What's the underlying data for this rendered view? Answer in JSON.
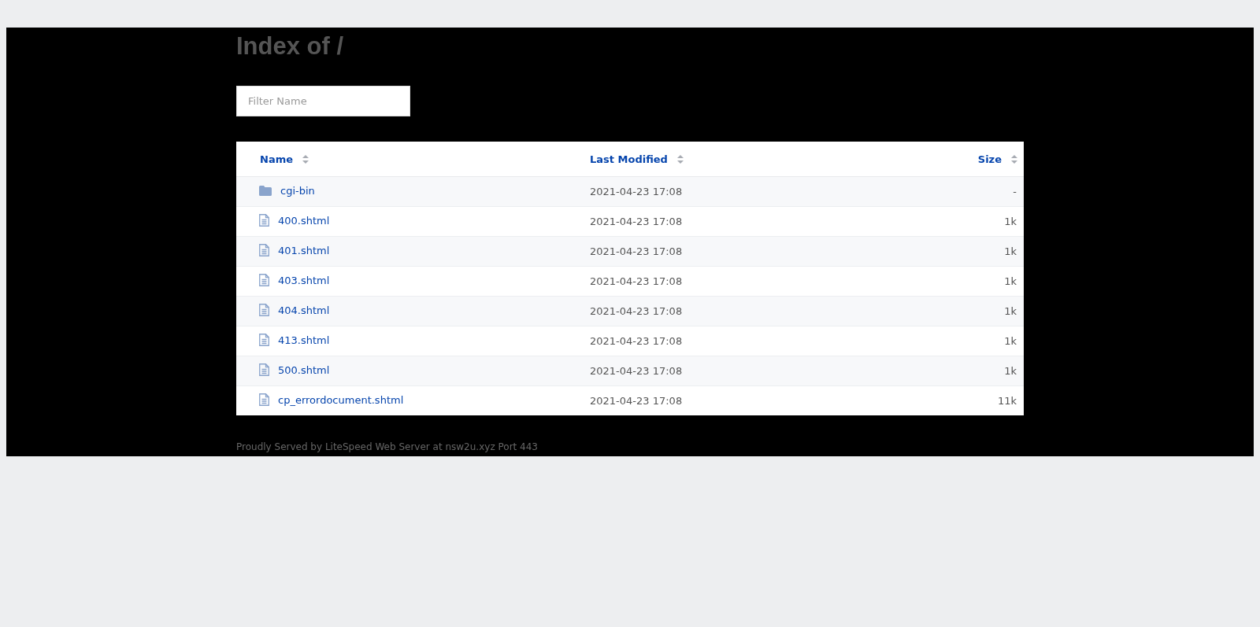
{
  "title": "Index of /",
  "filter": {
    "placeholder": "Filter Name"
  },
  "table": {
    "columns": [
      "Name",
      "Last Modified",
      "Size"
    ],
    "rows": [
      {
        "kind": "folder",
        "name": "cgi-bin",
        "modified": "2021-04-23 17:08",
        "size": "-"
      },
      {
        "kind": "file",
        "name": "400.shtml",
        "modified": "2021-04-23 17:08",
        "size": "1k"
      },
      {
        "kind": "file",
        "name": "401.shtml",
        "modified": "2021-04-23 17:08",
        "size": "1k"
      },
      {
        "kind": "file",
        "name": "403.shtml",
        "modified": "2021-04-23 17:08",
        "size": "1k"
      },
      {
        "kind": "file",
        "name": "404.shtml",
        "modified": "2021-04-23 17:08",
        "size": "1k"
      },
      {
        "kind": "file",
        "name": "413.shtml",
        "modified": "2021-04-23 17:08",
        "size": "1k"
      },
      {
        "kind": "file",
        "name": "500.shtml",
        "modified": "2021-04-23 17:08",
        "size": "1k"
      },
      {
        "kind": "file",
        "name": "cp_errordocument.shtml",
        "modified": "2021-04-23 17:08",
        "size": "11k"
      }
    ]
  },
  "footer": "Proudly Served by LiteSpeed Web Server at nsw2u.xyz Port 443"
}
